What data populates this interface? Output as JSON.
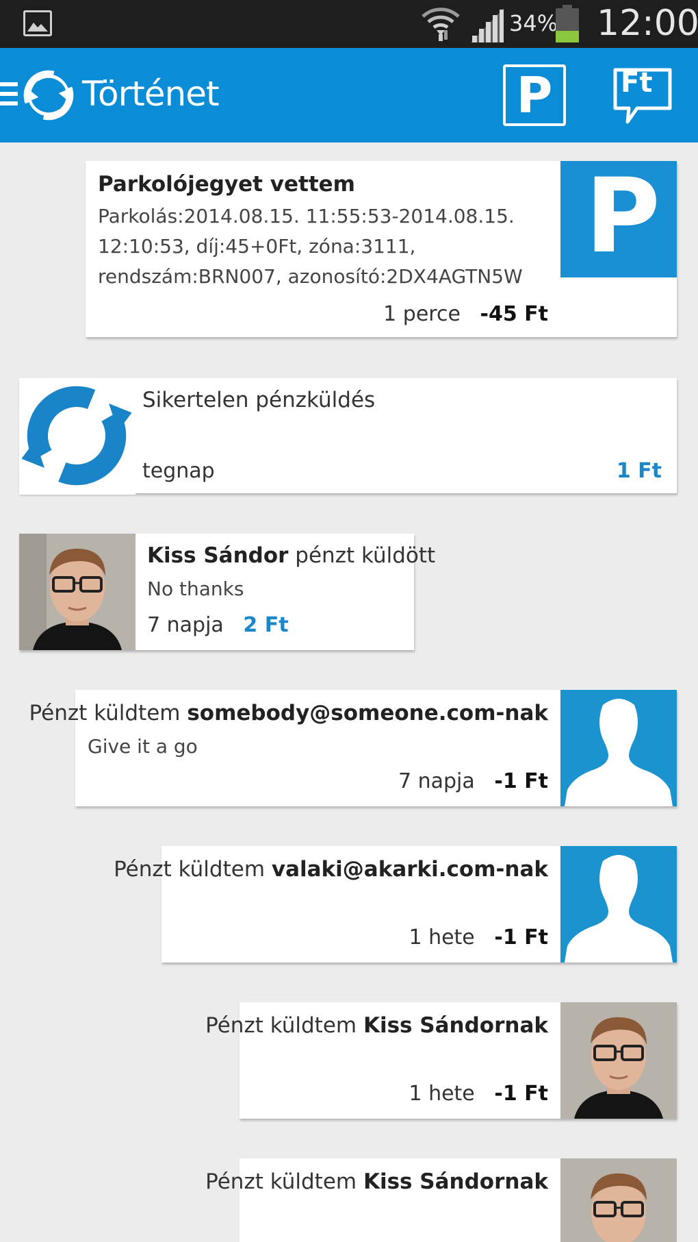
{
  "status_bar": {
    "battery_percent": "34%",
    "time": "12:00",
    "icons": [
      "gallery-icon",
      "wifi-icon",
      "signal-icon",
      "battery-icon"
    ]
  },
  "app_bar": {
    "title": "Történet",
    "parking_action_label": "P",
    "ft_action_label": "Ft",
    "accent_color": "#0a8dd6"
  },
  "history": [
    {
      "title": "Parkolójegyet vettem",
      "detail_line1": "Parkolás:2014.08.15. 11:55:53-2014.08.15.",
      "detail_line2": "12:10:53, díj:45+0Ft, zóna:3111,",
      "detail_line3": "rendszám:BRN007, azonosító:2DX4AGTN5W",
      "time": "1 perce",
      "amount": "-45 Ft",
      "thumb_label": "P"
    },
    {
      "title": "Sikertelen pénzküldés",
      "time": "tegnap",
      "amount": "1 Ft"
    },
    {
      "name": "Kiss Sándor",
      "action": "pénzt küldött",
      "message": "No thanks",
      "time": "7 napja",
      "amount": "2 Ft"
    },
    {
      "prefix": "Pénzt küldtem",
      "recipient": "somebody@someone.com-nak",
      "message": "Give it a go",
      "time": "7 napja",
      "amount": "-1 Ft"
    },
    {
      "prefix": "Pénzt küldtem",
      "recipient": "valaki@akarki.com-nak",
      "time": "1 hete",
      "amount": "-1 Ft"
    },
    {
      "prefix": "Pénzt küldtem",
      "recipient": "Kiss Sándornak",
      "time": "1 hete",
      "amount": "-1 Ft"
    },
    {
      "prefix": "Pénzt küldtem",
      "recipient": "Kiss Sándornak"
    }
  ]
}
